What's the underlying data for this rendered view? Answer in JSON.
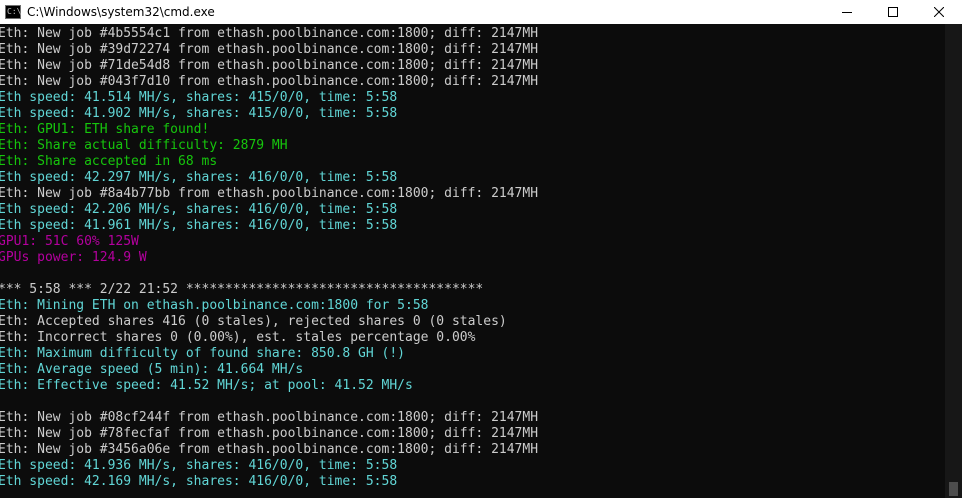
{
  "window": {
    "title": "C:\\Windows\\system32\\cmd.exe",
    "icon": "cmd-icon",
    "icon_glyph": "C:\\"
  },
  "controls": {
    "minimize_icon": "minimize-icon",
    "maximize_icon": "maximize-icon",
    "close_icon": "close-icon"
  },
  "colors": {
    "background": "#0c0c0c",
    "white": "#cccccc",
    "cyan": "#61d6d6",
    "green": "#16c60c",
    "magenta": "#b4009e"
  },
  "console": {
    "lines": [
      {
        "text": "Eth: New job #4b5554c1 from ethash.poolbinance.com:1800; diff: 2147MH",
        "color": "white"
      },
      {
        "text": "Eth: New job #39d72274 from ethash.poolbinance.com:1800; diff: 2147MH",
        "color": "white"
      },
      {
        "text": "Eth: New job #71de54d8 from ethash.poolbinance.com:1800; diff: 2147MH",
        "color": "white"
      },
      {
        "text": "Eth: New job #043f7d10 from ethash.poolbinance.com:1800; diff: 2147MH",
        "color": "white"
      },
      {
        "text": "Eth speed: 41.514 MH/s, shares: 415/0/0, time: 5:58",
        "color": "cyan"
      },
      {
        "text": "Eth speed: 41.902 MH/s, shares: 415/0/0, time: 5:58",
        "color": "cyan"
      },
      {
        "text": "Eth: GPU1: ETH share found!",
        "color": "green"
      },
      {
        "text": "Eth: Share actual difficulty: 2879 MH",
        "color": "green"
      },
      {
        "text": "Eth: Share accepted in 68 ms",
        "color": "green"
      },
      {
        "text": "Eth speed: 42.297 MH/s, shares: 416/0/0, time: 5:58",
        "color": "cyan"
      },
      {
        "text": "Eth: New job #8a4b77bb from ethash.poolbinance.com:1800; diff: 2147MH",
        "color": "white"
      },
      {
        "text": "Eth speed: 42.206 MH/s, shares: 416/0/0, time: 5:58",
        "color": "cyan"
      },
      {
        "text": "Eth speed: 41.961 MH/s, shares: 416/0/0, time: 5:58",
        "color": "cyan"
      },
      {
        "text": "GPU1: 51C 60% 125W",
        "color": "magenta"
      },
      {
        "text": "GPUs power: 124.9 W",
        "color": "magenta"
      },
      {
        "text": "",
        "color": "white"
      },
      {
        "text": "*** 5:58 *** 2/22 21:52 **************************************",
        "color": "white"
      },
      {
        "text": "Eth: Mining ETH on ethash.poolbinance.com:1800 for 5:58",
        "color": "cyan"
      },
      {
        "text": "Eth: Accepted shares 416 (0 stales), rejected shares 0 (0 stales)",
        "color": "white"
      },
      {
        "text": "Eth: Incorrect shares 0 (0.00%), est. stales percentage 0.00%",
        "color": "white"
      },
      {
        "text": "Eth: Maximum difficulty of found share: 850.8 GH (!)",
        "color": "cyan"
      },
      {
        "text": "Eth: Average speed (5 min): 41.664 MH/s",
        "color": "cyan"
      },
      {
        "text": "Eth: Effective speed: 41.52 MH/s; at pool: 41.52 MH/s",
        "color": "cyan"
      },
      {
        "text": "",
        "color": "white"
      },
      {
        "text": "Eth: New job #08cf244f from ethash.poolbinance.com:1800; diff: 2147MH",
        "color": "white"
      },
      {
        "text": "Eth: New job #78fecfaf from ethash.poolbinance.com:1800; diff: 2147MH",
        "color": "white"
      },
      {
        "text": "Eth: New job #3456a06e from ethash.poolbinance.com:1800; diff: 2147MH",
        "color": "white"
      },
      {
        "text": "Eth speed: 41.936 MH/s, shares: 416/0/0, time: 5:58",
        "color": "cyan"
      },
      {
        "text": "Eth speed: 42.169 MH/s, shares: 416/0/0, time: 5:58",
        "color": "cyan"
      }
    ]
  }
}
